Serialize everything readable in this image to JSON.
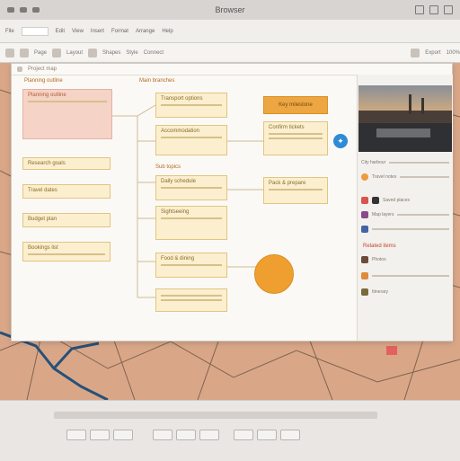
{
  "window": {
    "title": "Browser"
  },
  "toolbar": {
    "items": [
      "File",
      "Edit",
      "View",
      "Insert",
      "Format",
      "Arrange",
      "Help"
    ]
  },
  "iconbar": {
    "labels": [
      "Page",
      "Layout",
      "Shapes",
      "Style",
      "Connect",
      "Export"
    ],
    "zoom": "100%"
  },
  "app": {
    "header_text": "Project map"
  },
  "mindmap": {
    "root": {
      "label": "Planning outline"
    },
    "col_header": "Main branches",
    "mid_header": "Sub topics",
    "left_nodes": [
      "Research goals",
      "Travel dates",
      "Budget plan",
      "Bookings list"
    ],
    "mid_nodes": [
      "Transport options",
      "Accommodation",
      "Daily schedule",
      "Sightseeing",
      "Food & dining"
    ],
    "right_top": "Key milestone",
    "right_nodes": [
      "Confirm tickets",
      "Pack & prepare"
    ],
    "circle_label": ""
  },
  "right_panel": {
    "section_title": "Related items",
    "items": [
      "City harbour",
      "Travel notes",
      "Saved places",
      "Map layers",
      "Photos",
      "Itinerary"
    ]
  },
  "colors": {
    "accent": "#ef9f2f",
    "node_fill": "#fbefcf",
    "root_fill": "#f6d3c7",
    "map_bg": "#d9a788"
  }
}
